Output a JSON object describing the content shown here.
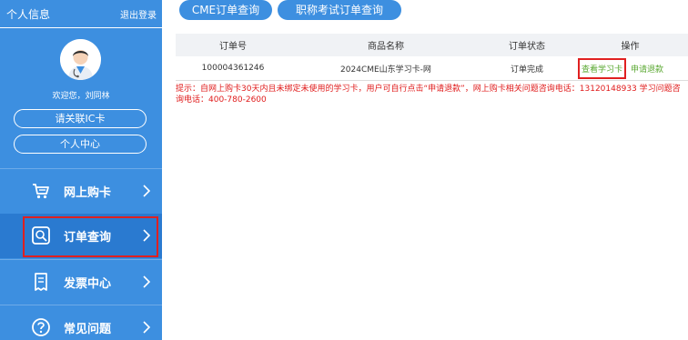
{
  "sidebar": {
    "title": "个人信息",
    "logout": "退出登录",
    "welcome": "欢迎您，刘同林",
    "buttons": {
      "link_ic": "请关联IC卡",
      "personal_center": "个人中心"
    },
    "nav": [
      {
        "label": "网上购卡",
        "icon": "cart-icon"
      },
      {
        "label": "订单查询",
        "icon": "search-order-icon",
        "active": true
      },
      {
        "label": "发票中心",
        "icon": "invoice-icon"
      },
      {
        "label": "常见问题",
        "icon": "question-icon"
      }
    ]
  },
  "tabs": [
    "CME订单查询",
    "职称考试订单查询"
  ],
  "table": {
    "headers": [
      "订单号",
      "商品名称",
      "订单状态",
      "操作"
    ],
    "rows": [
      {
        "order_no": "100004361246",
        "product": "2024CME山东学习卡-网",
        "status": "订单完成",
        "action_view": "查看学习卡",
        "action_refund": "申请退款"
      }
    ]
  },
  "tip": "提示：自网上购卡30天内且未绑定未使用的学习卡，用户可自行点击“申请退款”，网上购卡相关问题咨询电话：13120148933 学习问题咨询电话：400-780-2600",
  "colors": {
    "sidebar": "#3d8fe0",
    "active_nav": "#2a7ad0",
    "highlight": "#e02020",
    "link": "#5aa831",
    "tip": "#e01b1b"
  }
}
